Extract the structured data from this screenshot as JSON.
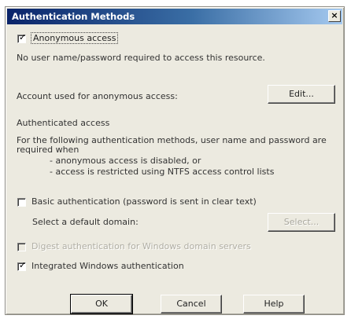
{
  "dialog": {
    "title": "Authentication Methods"
  },
  "anonymous": {
    "checkbox_label": "Anonymous access",
    "checked": true,
    "description": "No user name/password required to access this resource.",
    "account_label": "Account used for anonymous access:",
    "edit_button": "Edit..."
  },
  "authenticated": {
    "heading": "Authenticated access",
    "description_1": "For the following authentication methods, user name and password are",
    "description_2": "required when",
    "bullet_1": "- anonymous access is disabled, or",
    "bullet_2": "- access is restricted using NTFS access control lists"
  },
  "basic": {
    "checkbox_label": "Basic authentication (password is sent in clear text)",
    "checked": false,
    "domain_label": "Select a default domain:",
    "select_button": "Select..."
  },
  "digest": {
    "checkbox_label": "Digest authentication for Windows domain servers",
    "checked": false
  },
  "integrated": {
    "checkbox_label": "Integrated Windows authentication",
    "checked": true
  },
  "buttons": {
    "ok": "OK",
    "cancel": "Cancel",
    "help": "Help"
  }
}
